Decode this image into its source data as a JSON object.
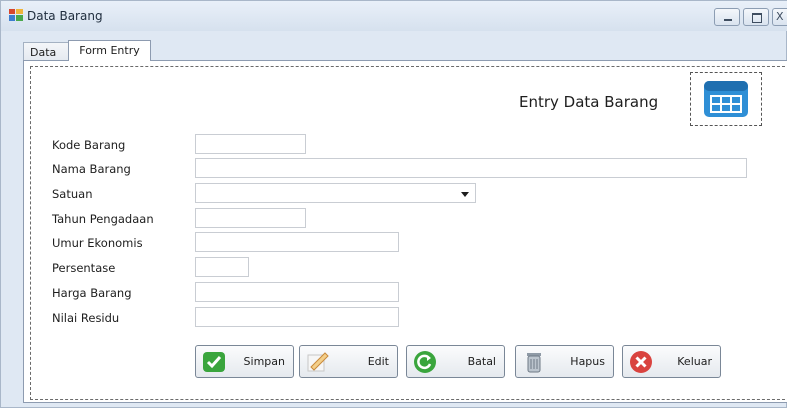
{
  "window": {
    "title": "Data Barang",
    "controls": {
      "close_glyph": "X"
    }
  },
  "tabs": [
    {
      "label": "Data"
    },
    {
      "label": "Form Entry"
    }
  ],
  "form": {
    "heading": "Entry Data Barang",
    "heading_icon": "table-icon",
    "fields": [
      {
        "label": "Kode Barang",
        "value": ""
      },
      {
        "label": "Nama Barang",
        "value": ""
      },
      {
        "label": "Satuan",
        "value": ""
      },
      {
        "label": "Tahun Pengadaan",
        "value": ""
      },
      {
        "label": "Umur Ekonomis",
        "value": ""
      },
      {
        "label": "Persentase",
        "value": ""
      },
      {
        "label": "Harga Barang",
        "value": ""
      },
      {
        "label": "Nilai Residu",
        "value": ""
      }
    ]
  },
  "buttons": [
    {
      "label": "Simpan",
      "icon": "check-icon"
    },
    {
      "label": "Edit",
      "icon": "pencil-icon"
    },
    {
      "label": "Batal",
      "icon": "undo-icon"
    },
    {
      "label": "Hapus",
      "icon": "trash-icon"
    },
    {
      "label": "Keluar",
      "icon": "close-icon"
    }
  ],
  "colors": {
    "window_bg": "#dfe8f3",
    "accent_blue": "#2f8fd6",
    "check_green": "#3aa53d",
    "close_red": "#d9433f"
  }
}
